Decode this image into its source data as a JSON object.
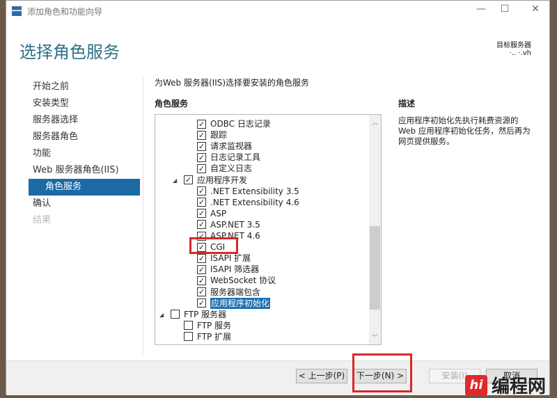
{
  "window": {
    "title": "添加角色和功能向导",
    "minimize": "—",
    "maximize": "☐",
    "close": "✕"
  },
  "page_title": "选择角色服务",
  "target_server": {
    "label": "目标服务器",
    "name": "·.. ·.vh"
  },
  "nav": [
    {
      "label": "开始之前",
      "state": "normal"
    },
    {
      "label": "安装类型",
      "state": "normal"
    },
    {
      "label": "服务器选择",
      "state": "normal"
    },
    {
      "label": "服务器角色",
      "state": "normal"
    },
    {
      "label": "功能",
      "state": "normal"
    },
    {
      "label": "Web 服务器角色(IIS)",
      "state": "normal"
    },
    {
      "label": "角色服务",
      "state": "selected"
    },
    {
      "label": "确认",
      "state": "normal"
    },
    {
      "label": "结果",
      "state": "disabled"
    }
  ],
  "instruction": "为Web 服务器(IIS)选择要安装的角色服务",
  "role_services_header": "角色服务",
  "items": [
    {
      "label": "ODBC 日志记录",
      "checked": true,
      "level": 2
    },
    {
      "label": "跟踪",
      "checked": true,
      "level": 2
    },
    {
      "label": "请求监视器",
      "checked": true,
      "level": 2
    },
    {
      "label": "日志记录工具",
      "checked": true,
      "level": 2
    },
    {
      "label": "自定义日志",
      "checked": true,
      "level": 2
    },
    {
      "label": "应用程序开发",
      "checked": true,
      "level": 1,
      "expanded": true
    },
    {
      "label": ".NET Extensibility 3.5",
      "checked": true,
      "level": 2
    },
    {
      "label": ".NET Extensibility 4.6",
      "checked": true,
      "level": 2
    },
    {
      "label": "ASP",
      "checked": true,
      "level": 2
    },
    {
      "label": "ASP.NET 3.5",
      "checked": true,
      "level": 2
    },
    {
      "label": "ASP.NET 4.6",
      "checked": true,
      "level": 2
    },
    {
      "label": "CGI",
      "checked": true,
      "level": 2,
      "highlighted_box": true
    },
    {
      "label": "ISAPI 扩展",
      "checked": true,
      "level": 2
    },
    {
      "label": "ISAPI 筛选器",
      "checked": true,
      "level": 2
    },
    {
      "label": "WebSocket 协议",
      "checked": true,
      "level": 2
    },
    {
      "label": "服务器端包含",
      "checked": true,
      "level": 2
    },
    {
      "label": "应用程序初始化",
      "checked": true,
      "level": 2,
      "selected": true
    },
    {
      "label": "FTP 服务器",
      "checked": false,
      "level": 0,
      "expanded": true
    },
    {
      "label": "FTP 服务",
      "checked": false,
      "level": 1
    },
    {
      "label": "FTP 扩展",
      "checked": false,
      "level": 1
    }
  ],
  "description": {
    "header": "描述",
    "text": "应用程序初始化先执行耗费资源的 Web 应用程序初始化任务，然后再为网页提供服务。"
  },
  "buttons": {
    "prev": "< 上一步(P)",
    "next": "下一步(N) >",
    "install": "安装(I)",
    "cancel": "取消"
  },
  "watermark": {
    "logo": "编程网"
  },
  "colors": {
    "accent": "#1b6aa5",
    "title": "#2f6f85",
    "highlight_box": "#d9262a"
  }
}
